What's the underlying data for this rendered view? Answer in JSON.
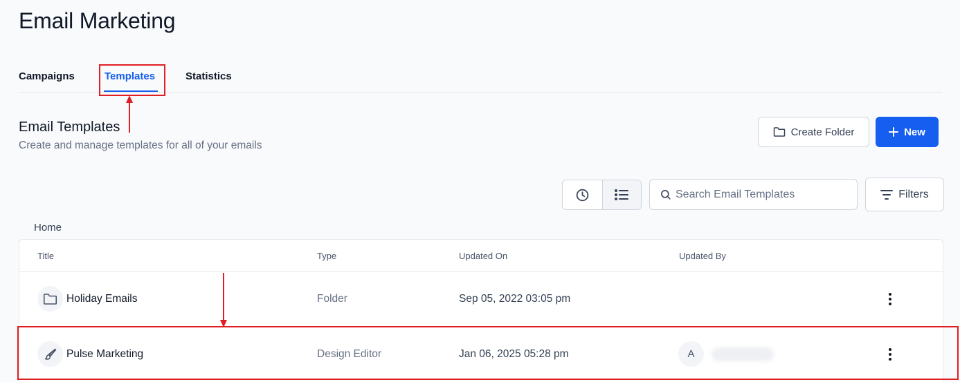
{
  "page": {
    "title": "Email Marketing"
  },
  "tabs": [
    {
      "label": "Campaigns"
    },
    {
      "label": "Templates",
      "active": true
    },
    {
      "label": "Statistics"
    }
  ],
  "section": {
    "title": "Email Templates",
    "subtitle": "Create and manage templates for all of your emails"
  },
  "actions": {
    "create_folder": "Create Folder",
    "new": "New",
    "filters": "Filters"
  },
  "search": {
    "placeholder": "Search Email Templates",
    "value": ""
  },
  "breadcrumb": "Home",
  "table": {
    "headers": [
      "Title",
      "Type",
      "Updated On",
      "Updated By"
    ],
    "rows": [
      {
        "icon": "folder-icon",
        "title": "Holiday Emails",
        "type": "Folder",
        "updated_on": "Sep 05, 2022 03:05 pm",
        "updated_by": ""
      },
      {
        "icon": "brush-icon",
        "title": "Pulse Marketing",
        "type": "Design Editor",
        "updated_on": "Jan 06, 2025 05:28 pm",
        "avatar_initial": "A"
      }
    ]
  },
  "colors": {
    "accent": "#155eef",
    "annotation": "#e11d24"
  }
}
